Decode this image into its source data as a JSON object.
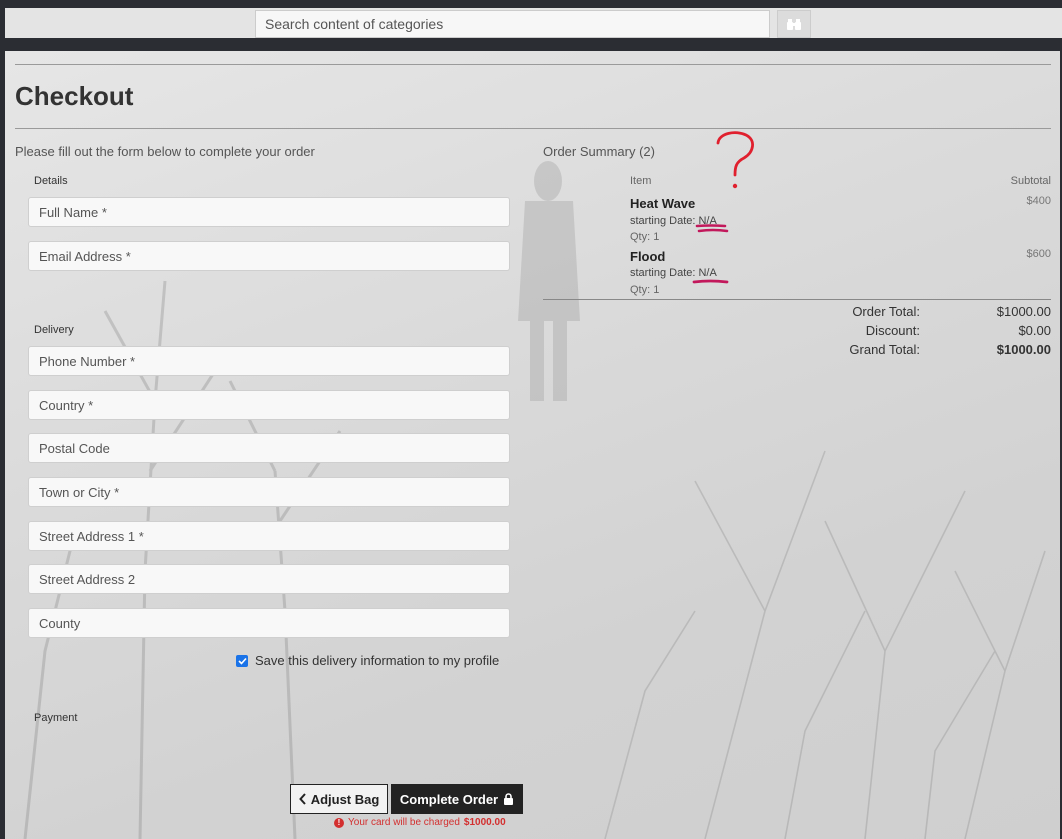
{
  "header": {
    "search_placeholder": "Search content of categories",
    "search_icon": "binoculars-icon"
  },
  "page": {
    "title": "Checkout",
    "intro": "Please fill out the form below to complete your order"
  },
  "form": {
    "details_label": "Details",
    "details_fields": [
      "Full Name *",
      "Email Address *"
    ],
    "delivery_label": "Delivery",
    "delivery_fields": [
      "Phone Number *",
      "Country *",
      "Postal Code",
      "Town or City *",
      "Street Address 1 *",
      "Street Address 2",
      "County"
    ],
    "save_info_label": "Save this delivery information to my profile",
    "save_info_checked": true,
    "payment_label": "Payment"
  },
  "summary": {
    "title": "Order Summary (2)",
    "col_item": "Item",
    "col_subtotal": "Subtotal",
    "items": [
      {
        "name": "Heat Wave",
        "date_label": "starting Date:",
        "date_value": "N/A",
        "qty": "Qty: 1",
        "subtotal": "$400"
      },
      {
        "name": "Flood",
        "date_label": "starting Date:",
        "date_value": "N/A",
        "qty": "Qty: 1",
        "subtotal": "$600"
      }
    ],
    "order_total_label": "Order Total:",
    "order_total": "$1000.00",
    "discount_label": "Discount:",
    "discount": "$0.00",
    "grand_total_label": "Grand Total:",
    "grand_total": "$1000.00"
  },
  "actions": {
    "adjust_label": "Adjust Bag",
    "complete_label": "Complete Order",
    "charge_text": "Your card will be charged",
    "charge_amount": "$1000.00"
  },
  "colors": {
    "accent_dark": "#222222",
    "checkbox_blue": "#1a73e8",
    "warning_red": "#d32f2f",
    "annotation_red": "#e0202e",
    "annotation_magenta": "#c2185b"
  }
}
